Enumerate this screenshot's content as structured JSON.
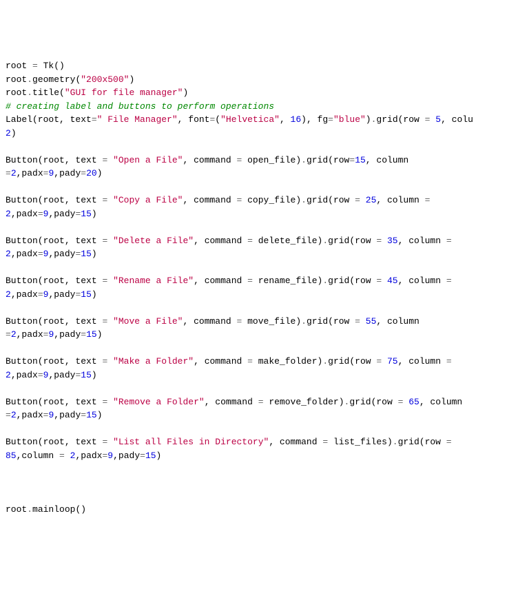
{
  "lines": [
    {
      "segments": [
        {
          "t": "root ",
          "c": "s-name"
        },
        {
          "t": "=",
          "c": "s-op"
        },
        {
          "t": " Tk()",
          "c": "s-name"
        }
      ]
    },
    {
      "segments": [
        {
          "t": "root",
          "c": "s-name"
        },
        {
          "t": ".",
          "c": "s-op"
        },
        {
          "t": "geometry(",
          "c": "s-name"
        },
        {
          "t": "\"200x500\"",
          "c": "s-string"
        },
        {
          "t": ")",
          "c": "s-name"
        }
      ]
    },
    {
      "segments": [
        {
          "t": "root",
          "c": "s-name"
        },
        {
          "t": ".",
          "c": "s-op"
        },
        {
          "t": "title(",
          "c": "s-name"
        },
        {
          "t": "\"GUI for file manager\"",
          "c": "s-string"
        },
        {
          "t": ")",
          "c": "s-name"
        }
      ]
    },
    {
      "segments": [
        {
          "t": "# creating label and buttons to perform operations",
          "c": "s-comment"
        }
      ]
    },
    {
      "segments": [
        {
          "t": "Label(root, text",
          "c": "s-name"
        },
        {
          "t": "=",
          "c": "s-op"
        },
        {
          "t": "\" File Manager\"",
          "c": "s-string"
        },
        {
          "t": ", font",
          "c": "s-name"
        },
        {
          "t": "=",
          "c": "s-op"
        },
        {
          "t": "(",
          "c": "s-name"
        },
        {
          "t": "\"Helvetica\"",
          "c": "s-string"
        },
        {
          "t": ", ",
          "c": "s-name"
        },
        {
          "t": "16",
          "c": "s-number"
        },
        {
          "t": "), fg",
          "c": "s-name"
        },
        {
          "t": "=",
          "c": "s-op"
        },
        {
          "t": "\"blue\"",
          "c": "s-string"
        },
        {
          "t": ")",
          "c": "s-name"
        },
        {
          "t": ".",
          "c": "s-op"
        },
        {
          "t": "grid(row ",
          "c": "s-name"
        },
        {
          "t": "=",
          "c": "s-op"
        },
        {
          "t": " ",
          "c": "s-name"
        },
        {
          "t": "5",
          "c": "s-number"
        },
        {
          "t": ", colu",
          "c": "s-name"
        }
      ]
    },
    {
      "segments": [
        {
          "t": "2",
          "c": "s-number"
        },
        {
          "t": ")",
          "c": "s-name"
        }
      ]
    },
    {
      "segments": []
    },
    {
      "segments": [
        {
          "t": "Button(root, text ",
          "c": "s-name"
        },
        {
          "t": "=",
          "c": "s-op"
        },
        {
          "t": " ",
          "c": "s-name"
        },
        {
          "t": "\"Open a File\"",
          "c": "s-string"
        },
        {
          "t": ", command ",
          "c": "s-name"
        },
        {
          "t": "=",
          "c": "s-op"
        },
        {
          "t": " open_file)",
          "c": "s-name"
        },
        {
          "t": ".",
          "c": "s-op"
        },
        {
          "t": "grid(row",
          "c": "s-name"
        },
        {
          "t": "=",
          "c": "s-op"
        },
        {
          "t": "15",
          "c": "s-number"
        },
        {
          "t": ", column ",
          "c": "s-name"
        }
      ]
    },
    {
      "segments": [
        {
          "t": "=",
          "c": "s-op"
        },
        {
          "t": "2",
          "c": "s-number"
        },
        {
          "t": ",padx",
          "c": "s-name"
        },
        {
          "t": "=",
          "c": "s-op"
        },
        {
          "t": "9",
          "c": "s-number"
        },
        {
          "t": ",pady",
          "c": "s-name"
        },
        {
          "t": "=",
          "c": "s-op"
        },
        {
          "t": "20",
          "c": "s-number"
        },
        {
          "t": ")",
          "c": "s-name"
        }
      ]
    },
    {
      "segments": []
    },
    {
      "segments": [
        {
          "t": "Button(root, text ",
          "c": "s-name"
        },
        {
          "t": "=",
          "c": "s-op"
        },
        {
          "t": " ",
          "c": "s-name"
        },
        {
          "t": "\"Copy a File\"",
          "c": "s-string"
        },
        {
          "t": ", command ",
          "c": "s-name"
        },
        {
          "t": "=",
          "c": "s-op"
        },
        {
          "t": " copy_file)",
          "c": "s-name"
        },
        {
          "t": ".",
          "c": "s-op"
        },
        {
          "t": "grid(row ",
          "c": "s-name"
        },
        {
          "t": "=",
          "c": "s-op"
        },
        {
          "t": " ",
          "c": "s-name"
        },
        {
          "t": "25",
          "c": "s-number"
        },
        {
          "t": ", column ",
          "c": "s-name"
        },
        {
          "t": "=",
          "c": "s-op"
        },
        {
          "t": " ",
          "c": "s-name"
        }
      ]
    },
    {
      "segments": [
        {
          "t": "2",
          "c": "s-number"
        },
        {
          "t": ",padx",
          "c": "s-name"
        },
        {
          "t": "=",
          "c": "s-op"
        },
        {
          "t": "9",
          "c": "s-number"
        },
        {
          "t": ",pady",
          "c": "s-name"
        },
        {
          "t": "=",
          "c": "s-op"
        },
        {
          "t": "15",
          "c": "s-number"
        },
        {
          "t": ")",
          "c": "s-name"
        }
      ]
    },
    {
      "segments": []
    },
    {
      "segments": [
        {
          "t": "Button(root, text ",
          "c": "s-name"
        },
        {
          "t": "=",
          "c": "s-op"
        },
        {
          "t": " ",
          "c": "s-name"
        },
        {
          "t": "\"Delete a File\"",
          "c": "s-string"
        },
        {
          "t": ", command ",
          "c": "s-name"
        },
        {
          "t": "=",
          "c": "s-op"
        },
        {
          "t": " delete_file)",
          "c": "s-name"
        },
        {
          "t": ".",
          "c": "s-op"
        },
        {
          "t": "grid(row ",
          "c": "s-name"
        },
        {
          "t": "=",
          "c": "s-op"
        },
        {
          "t": " ",
          "c": "s-name"
        },
        {
          "t": "35",
          "c": "s-number"
        },
        {
          "t": ", column ",
          "c": "s-name"
        },
        {
          "t": "=",
          "c": "s-op"
        },
        {
          "t": " ",
          "c": "s-name"
        }
      ]
    },
    {
      "segments": [
        {
          "t": "2",
          "c": "s-number"
        },
        {
          "t": ",padx",
          "c": "s-name"
        },
        {
          "t": "=",
          "c": "s-op"
        },
        {
          "t": "9",
          "c": "s-number"
        },
        {
          "t": ",pady",
          "c": "s-name"
        },
        {
          "t": "=",
          "c": "s-op"
        },
        {
          "t": "15",
          "c": "s-number"
        },
        {
          "t": ")",
          "c": "s-name"
        }
      ]
    },
    {
      "segments": []
    },
    {
      "segments": [
        {
          "t": "Button(root, text ",
          "c": "s-name"
        },
        {
          "t": "=",
          "c": "s-op"
        },
        {
          "t": " ",
          "c": "s-name"
        },
        {
          "t": "\"Rename a File\"",
          "c": "s-string"
        },
        {
          "t": ", command ",
          "c": "s-name"
        },
        {
          "t": "=",
          "c": "s-op"
        },
        {
          "t": " rename_file)",
          "c": "s-name"
        },
        {
          "t": ".",
          "c": "s-op"
        },
        {
          "t": "grid(row ",
          "c": "s-name"
        },
        {
          "t": "=",
          "c": "s-op"
        },
        {
          "t": " ",
          "c": "s-name"
        },
        {
          "t": "45",
          "c": "s-number"
        },
        {
          "t": ", column ",
          "c": "s-name"
        },
        {
          "t": "=",
          "c": "s-op"
        },
        {
          "t": " ",
          "c": "s-name"
        }
      ]
    },
    {
      "segments": [
        {
          "t": "2",
          "c": "s-number"
        },
        {
          "t": ",padx",
          "c": "s-name"
        },
        {
          "t": "=",
          "c": "s-op"
        },
        {
          "t": "9",
          "c": "s-number"
        },
        {
          "t": ",pady",
          "c": "s-name"
        },
        {
          "t": "=",
          "c": "s-op"
        },
        {
          "t": "15",
          "c": "s-number"
        },
        {
          "t": ")",
          "c": "s-name"
        }
      ]
    },
    {
      "segments": []
    },
    {
      "segments": [
        {
          "t": "Button(root, text ",
          "c": "s-name"
        },
        {
          "t": "=",
          "c": "s-op"
        },
        {
          "t": " ",
          "c": "s-name"
        },
        {
          "t": "\"Move a File\"",
          "c": "s-string"
        },
        {
          "t": ", command ",
          "c": "s-name"
        },
        {
          "t": "=",
          "c": "s-op"
        },
        {
          "t": " move_file)",
          "c": "s-name"
        },
        {
          "t": ".",
          "c": "s-op"
        },
        {
          "t": "grid(row ",
          "c": "s-name"
        },
        {
          "t": "=",
          "c": "s-op"
        },
        {
          "t": " ",
          "c": "s-name"
        },
        {
          "t": "55",
          "c": "s-number"
        },
        {
          "t": ", column ",
          "c": "s-name"
        }
      ]
    },
    {
      "segments": [
        {
          "t": "=",
          "c": "s-op"
        },
        {
          "t": "2",
          "c": "s-number"
        },
        {
          "t": ",padx",
          "c": "s-name"
        },
        {
          "t": "=",
          "c": "s-op"
        },
        {
          "t": "9",
          "c": "s-number"
        },
        {
          "t": ",pady",
          "c": "s-name"
        },
        {
          "t": "=",
          "c": "s-op"
        },
        {
          "t": "15",
          "c": "s-number"
        },
        {
          "t": ")",
          "c": "s-name"
        }
      ]
    },
    {
      "segments": []
    },
    {
      "segments": [
        {
          "t": "Button(root, text ",
          "c": "s-name"
        },
        {
          "t": "=",
          "c": "s-op"
        },
        {
          "t": " ",
          "c": "s-name"
        },
        {
          "t": "\"Make a Folder\"",
          "c": "s-string"
        },
        {
          "t": ", command ",
          "c": "s-name"
        },
        {
          "t": "=",
          "c": "s-op"
        },
        {
          "t": " make_folder)",
          "c": "s-name"
        },
        {
          "t": ".",
          "c": "s-op"
        },
        {
          "t": "grid(row ",
          "c": "s-name"
        },
        {
          "t": "=",
          "c": "s-op"
        },
        {
          "t": " ",
          "c": "s-name"
        },
        {
          "t": "75",
          "c": "s-number"
        },
        {
          "t": ", column ",
          "c": "s-name"
        },
        {
          "t": "=",
          "c": "s-op"
        },
        {
          "t": " ",
          "c": "s-name"
        }
      ]
    },
    {
      "segments": [
        {
          "t": "2",
          "c": "s-number"
        },
        {
          "t": ",padx",
          "c": "s-name"
        },
        {
          "t": "=",
          "c": "s-op"
        },
        {
          "t": "9",
          "c": "s-number"
        },
        {
          "t": ",pady",
          "c": "s-name"
        },
        {
          "t": "=",
          "c": "s-op"
        },
        {
          "t": "15",
          "c": "s-number"
        },
        {
          "t": ")",
          "c": "s-name"
        }
      ]
    },
    {
      "segments": []
    },
    {
      "segments": [
        {
          "t": "Button(root, text ",
          "c": "s-name"
        },
        {
          "t": "=",
          "c": "s-op"
        },
        {
          "t": " ",
          "c": "s-name"
        },
        {
          "t": "\"Remove a Folder\"",
          "c": "s-string"
        },
        {
          "t": ", command ",
          "c": "s-name"
        },
        {
          "t": "=",
          "c": "s-op"
        },
        {
          "t": " remove_folder)",
          "c": "s-name"
        },
        {
          "t": ".",
          "c": "s-op"
        },
        {
          "t": "grid(row ",
          "c": "s-name"
        },
        {
          "t": "=",
          "c": "s-op"
        },
        {
          "t": " ",
          "c": "s-name"
        },
        {
          "t": "65",
          "c": "s-number"
        },
        {
          "t": ", column ",
          "c": "s-name"
        }
      ]
    },
    {
      "segments": [
        {
          "t": "=",
          "c": "s-op"
        },
        {
          "t": "2",
          "c": "s-number"
        },
        {
          "t": ",padx",
          "c": "s-name"
        },
        {
          "t": "=",
          "c": "s-op"
        },
        {
          "t": "9",
          "c": "s-number"
        },
        {
          "t": ",pady",
          "c": "s-name"
        },
        {
          "t": "=",
          "c": "s-op"
        },
        {
          "t": "15",
          "c": "s-number"
        },
        {
          "t": ")",
          "c": "s-name"
        }
      ]
    },
    {
      "segments": []
    },
    {
      "segments": [
        {
          "t": "Button(root, text ",
          "c": "s-name"
        },
        {
          "t": "=",
          "c": "s-op"
        },
        {
          "t": " ",
          "c": "s-name"
        },
        {
          "t": "\"List all Files in Directory\"",
          "c": "s-string"
        },
        {
          "t": ", command ",
          "c": "s-name"
        },
        {
          "t": "=",
          "c": "s-op"
        },
        {
          "t": " list_files)",
          "c": "s-name"
        },
        {
          "t": ".",
          "c": "s-op"
        },
        {
          "t": "grid(row ",
          "c": "s-name"
        },
        {
          "t": "=",
          "c": "s-op"
        },
        {
          "t": " ",
          "c": "s-name"
        }
      ]
    },
    {
      "segments": [
        {
          "t": "85",
          "c": "s-number"
        },
        {
          "t": ",column ",
          "c": "s-name"
        },
        {
          "t": "=",
          "c": "s-op"
        },
        {
          "t": " ",
          "c": "s-name"
        },
        {
          "t": "2",
          "c": "s-number"
        },
        {
          "t": ",padx",
          "c": "s-name"
        },
        {
          "t": "=",
          "c": "s-op"
        },
        {
          "t": "9",
          "c": "s-number"
        },
        {
          "t": ",pady",
          "c": "s-name"
        },
        {
          "t": "=",
          "c": "s-op"
        },
        {
          "t": "15",
          "c": "s-number"
        },
        {
          "t": ")",
          "c": "s-name"
        }
      ]
    },
    {
      "segments": []
    },
    {
      "segments": []
    },
    {
      "segments": []
    },
    {
      "segments": [
        {
          "t": "root",
          "c": "s-name"
        },
        {
          "t": ".",
          "c": "s-op"
        },
        {
          "t": "mainloop()",
          "c": "s-name"
        }
      ]
    }
  ]
}
